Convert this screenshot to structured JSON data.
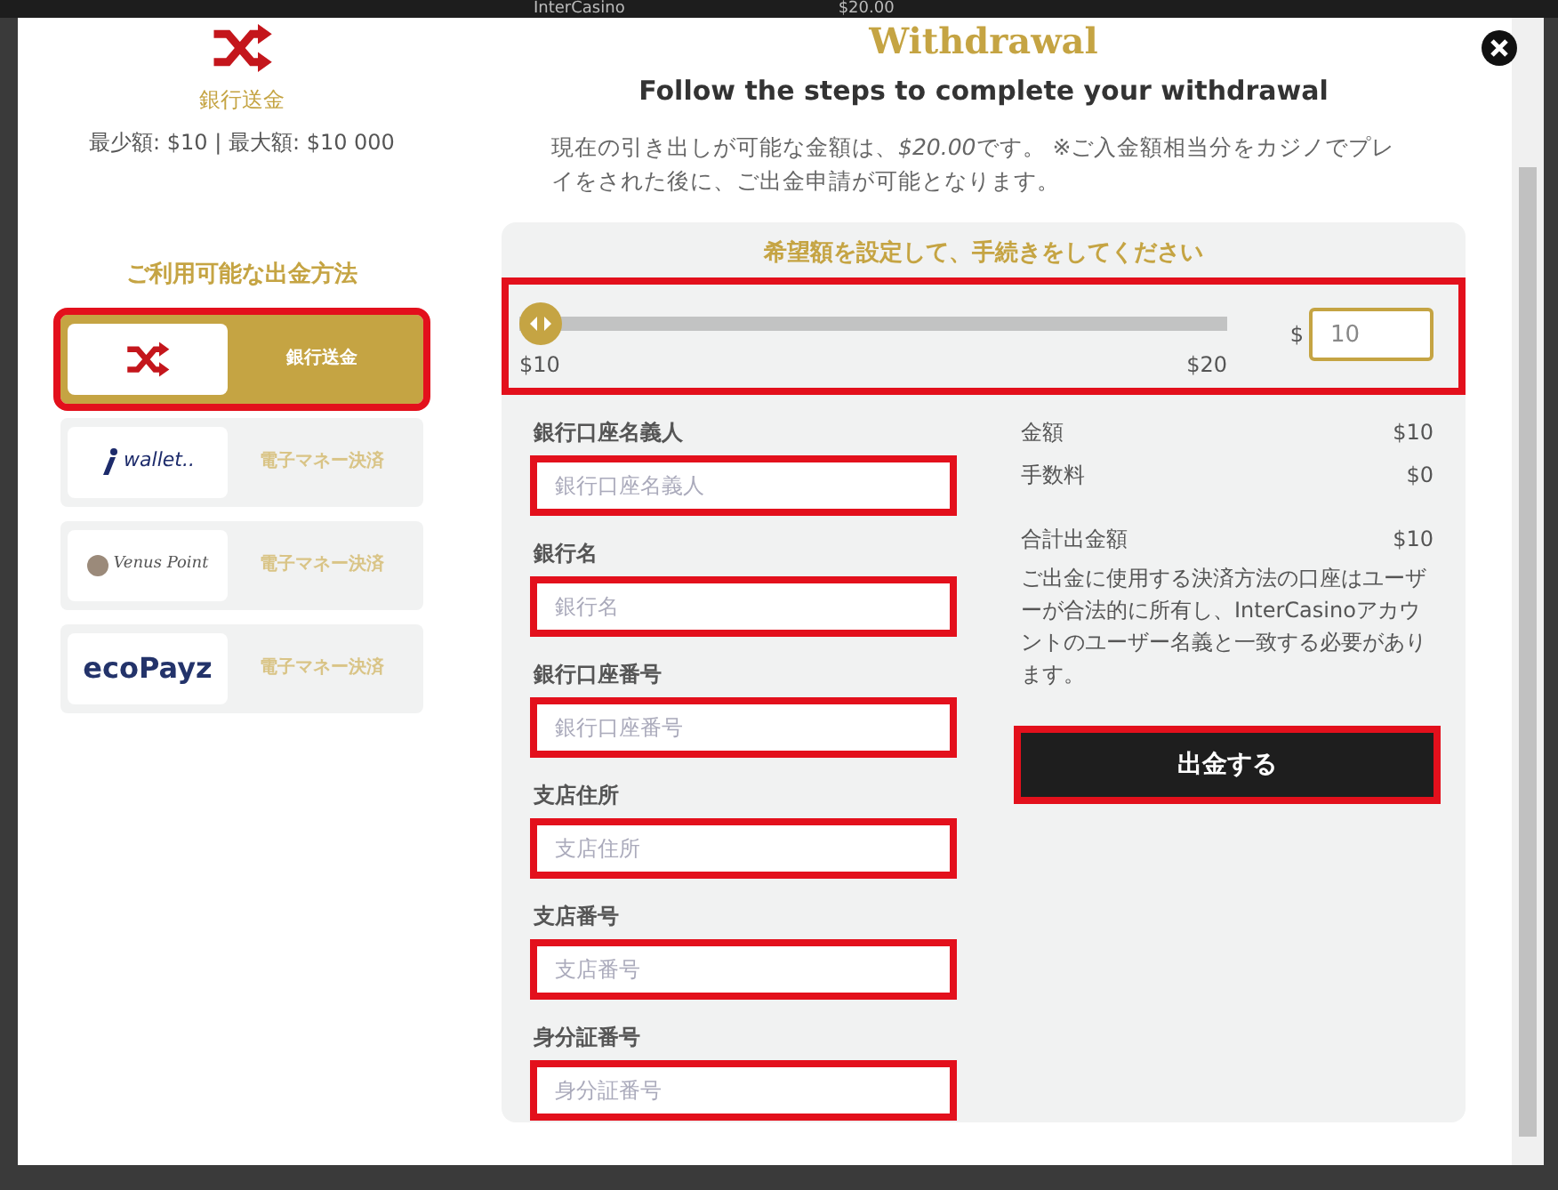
{
  "backdrop": {
    "logo": "InterCasino",
    "balance": "$20.00"
  },
  "modal": {
    "title": "Withdrawal",
    "subtitle": "Follow the steps to complete your withdrawal",
    "description": {
      "before": "現在の引き出しが可能な金額は、",
      "amount": "$20.00",
      "after": "です。 ※ご入金額相当分をカジノでプレイをされた後に、ご出金申請が可能となります。"
    }
  },
  "selected_method": {
    "name": "銀行送金",
    "limits": "最少額: $10 | 最大額: $10 000"
  },
  "methods_heading": "ご利用可能な出金方法",
  "methods": [
    {
      "kind": "bank",
      "label": "銀行送金",
      "selected": true,
      "highlighted": true
    },
    {
      "kind": "iwallet",
      "logo": "wallet..",
      "label": "電子マネー決済",
      "selected": false,
      "highlighted": false
    },
    {
      "kind": "venus",
      "logo": "Venus Point",
      "label": "電子マネー決済",
      "selected": false,
      "highlighted": false
    },
    {
      "kind": "ecopayz",
      "logo": "ecoPayz",
      "label": "電子マネー決済",
      "selected": false,
      "highlighted": false
    }
  ],
  "amount": {
    "heading": "希望額を設定して、手続きをしてください",
    "level": 0,
    "min_label": "$10",
    "max_label": "$20",
    "currency": "$",
    "value": "10",
    "highlighted": true
  },
  "fields": [
    {
      "label": "銀行口座名義人",
      "placeholder": "銀行口座名義人",
      "highlighted": true
    },
    {
      "label": "銀行名",
      "placeholder": "銀行名",
      "highlighted": true
    },
    {
      "label": "銀行口座番号",
      "placeholder": "銀行口座番号",
      "highlighted": true
    },
    {
      "label": "支店住所",
      "placeholder": "支店住所",
      "highlighted": true
    },
    {
      "label": "支店番号",
      "placeholder": "支店番号",
      "highlighted": true
    },
    {
      "label": "身分証番号",
      "placeholder": "身分証番号",
      "highlighted": true
    }
  ],
  "summary": [
    {
      "label": "金額",
      "value": "$10"
    },
    {
      "label": "手数料",
      "value": "$0"
    },
    {
      "label": "合計出金額",
      "value": "$10"
    }
  ],
  "notice": "ご出金に使用する決済方法の口座はユーザーが合法的に所有し、InterCasinoアカウントのユーザー名義と一致する必要があります。",
  "submit": {
    "label": "出金する",
    "highlighted": true
  }
}
